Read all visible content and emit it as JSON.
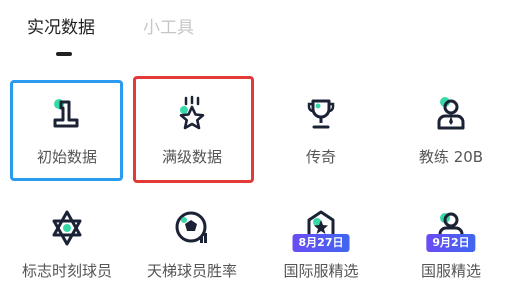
{
  "tabs": {
    "active": "实况数据",
    "inactive": "小工具"
  },
  "grid": {
    "row1": [
      {
        "label": "初始数据",
        "icon": "number-one-podium-icon"
      },
      {
        "label": "满级数据",
        "icon": "star-rays-icon"
      },
      {
        "label": "传奇",
        "icon": "trophy-icon"
      },
      {
        "label": "教练 20B",
        "icon": "coach-icon"
      }
    ],
    "row2": [
      {
        "label": "标志时刻球员",
        "icon": "hexagram-star-icon"
      },
      {
        "label": "天梯球员胜率",
        "icon": "soccer-ball-chart-icon"
      },
      {
        "label": "国际服精选",
        "icon": "star-badge-icon",
        "badge": "8月27日"
      },
      {
        "label": "国服精选",
        "icon": "person-badge-icon",
        "badge": "9月2日"
      }
    ]
  },
  "colors": {
    "accent_green": "#37d9a6",
    "highlight_blue": "#2b9bf0",
    "highlight_red": "#e23a36",
    "icon_dark": "#1c2235",
    "badge_purple": "#5a55f3"
  }
}
